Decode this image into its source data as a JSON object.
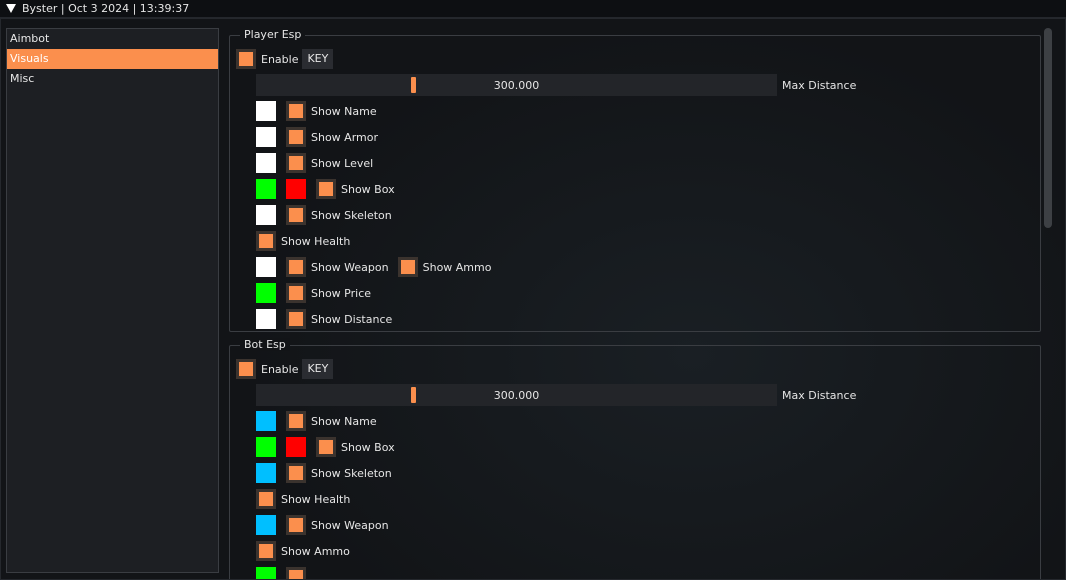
{
  "window": {
    "title": "Byster | Oct  3 2024 | 13:39:37"
  },
  "sidebar": {
    "items": [
      {
        "label": "Aimbot",
        "active": false
      },
      {
        "label": "Visuals",
        "active": true
      },
      {
        "label": "Misc",
        "active": false
      }
    ]
  },
  "player_esp": {
    "title": "Player Esp",
    "enable_label": "Enable",
    "key_label": "KEY",
    "max_distance": {
      "value": "300.000",
      "label": "Max Distance",
      "fraction": 0.3
    },
    "options": [
      {
        "colors": [
          "#ffffff"
        ],
        "label": "Show Name"
      },
      {
        "colors": [
          "#ffffff"
        ],
        "label": "Show Armor"
      },
      {
        "colors": [
          "#ffffff"
        ],
        "label": "Show Level"
      },
      {
        "colors": [
          "#00ff00",
          "#ff0000"
        ],
        "label": "Show Box"
      },
      {
        "colors": [
          "#ffffff"
        ],
        "label": "Show Skeleton"
      },
      {
        "colors": [],
        "label": "Show Health"
      },
      {
        "colors": [
          "#ffffff"
        ],
        "label": "Show Weapon",
        "extra_label": "Show Ammo"
      },
      {
        "colors": [
          "#00ff00"
        ],
        "label": "Show Price"
      },
      {
        "colors": [
          "#ffffff"
        ],
        "label": "Show Distance"
      }
    ]
  },
  "bot_esp": {
    "title": "Bot Esp",
    "enable_label": "Enable",
    "key_label": "KEY",
    "max_distance": {
      "value": "300.000",
      "label": "Max Distance",
      "fraction": 0.3
    },
    "options": [
      {
        "colors": [
          "#00bfff"
        ],
        "label": "Show Name"
      },
      {
        "colors": [
          "#00ff00",
          "#ff0000"
        ],
        "label": "Show Box"
      },
      {
        "colors": [
          "#00bfff"
        ],
        "label": "Show Skeleton"
      },
      {
        "colors": [],
        "label": "Show Health"
      },
      {
        "colors": [
          "#00bfff"
        ],
        "label": "Show Weapon"
      },
      {
        "colors": [],
        "label": "Show Ammo"
      },
      {
        "colors": [
          "#00ff00"
        ],
        "label": ""
      }
    ]
  },
  "colors": {
    "accent": "#fb8f4d",
    "background": "#121417",
    "panel": "#1d1f23"
  }
}
